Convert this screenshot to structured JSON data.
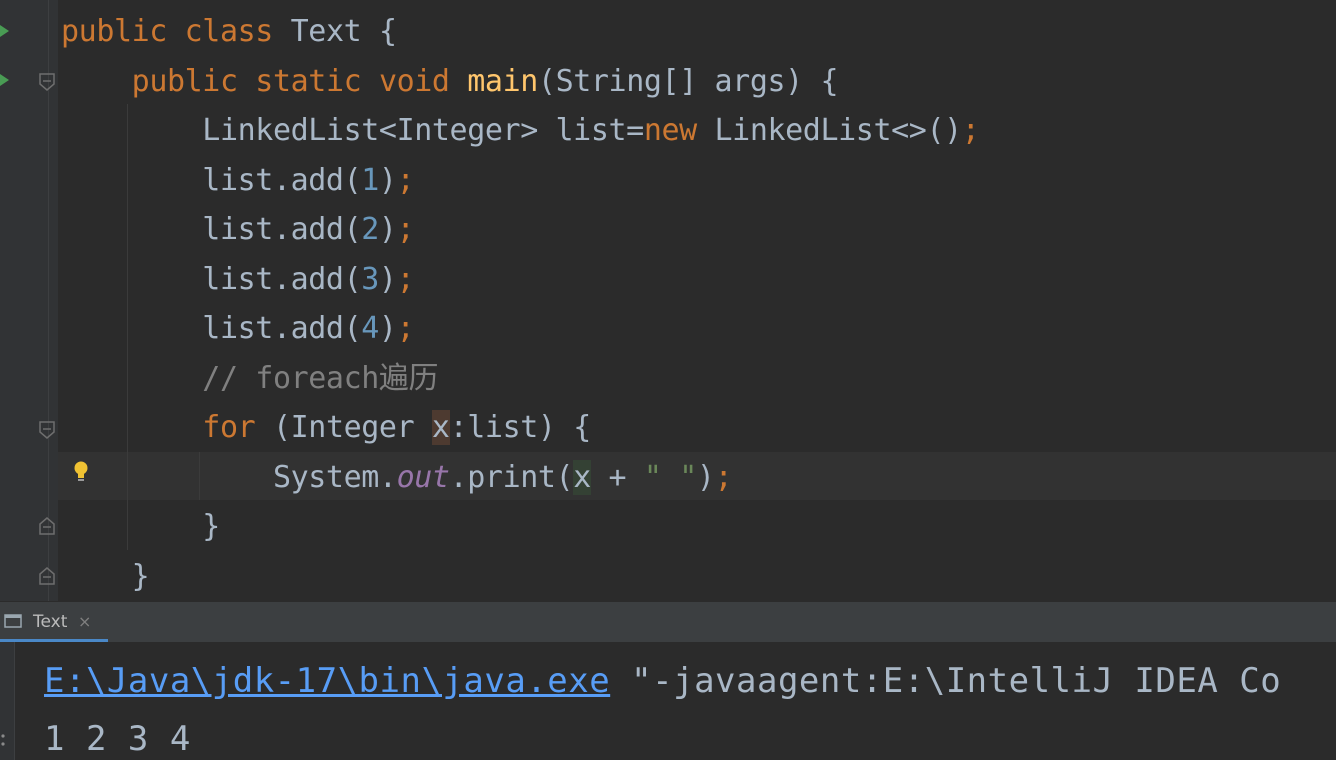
{
  "editor": {
    "lines": [
      {
        "parts": [
          [
            "kw",
            "public "
          ],
          [
            "kw",
            "class "
          ],
          [
            "plain",
            "Text "
          ],
          [
            "plain",
            "{"
          ]
        ]
      },
      {
        "parts": [
          [
            "plain",
            "    "
          ],
          [
            "kw",
            "public "
          ],
          [
            "kw",
            "static "
          ],
          [
            "kw",
            "void "
          ],
          [
            "fn",
            "main"
          ],
          [
            "plain",
            "(String[] args) {"
          ]
        ]
      },
      {
        "parts": [
          [
            "plain",
            "        LinkedList<Integer> list="
          ],
          [
            "kw",
            "new "
          ],
          [
            "plain",
            "LinkedList<>()"
          ],
          [
            "punct",
            ";"
          ]
        ]
      },
      {
        "parts": [
          [
            "plain",
            "        list.add("
          ],
          [
            "num",
            "1"
          ],
          [
            "plain",
            ")"
          ],
          [
            "punct",
            ";"
          ]
        ]
      },
      {
        "parts": [
          [
            "plain",
            "        list.add("
          ],
          [
            "num",
            "2"
          ],
          [
            "plain",
            ")"
          ],
          [
            "punct",
            ";"
          ]
        ]
      },
      {
        "parts": [
          [
            "plain",
            "        list.add("
          ],
          [
            "num",
            "3"
          ],
          [
            "plain",
            ")"
          ],
          [
            "punct",
            ";"
          ]
        ]
      },
      {
        "parts": [
          [
            "plain",
            "        list.add("
          ],
          [
            "num",
            "4"
          ],
          [
            "plain",
            ")"
          ],
          [
            "punct",
            ";"
          ]
        ]
      },
      {
        "parts": [
          [
            "plain",
            "        "
          ],
          [
            "cmt",
            "// foreach遍历"
          ]
        ]
      },
      {
        "parts": [
          [
            "plain",
            "        "
          ],
          [
            "kw",
            "for "
          ],
          [
            "plain",
            "(Integer "
          ],
          [
            "varhl",
            "x"
          ],
          [
            "plain",
            ":list) {"
          ]
        ]
      },
      {
        "parts": [
          [
            "plain",
            "            System."
          ],
          [
            "static",
            "out"
          ],
          [
            "plain",
            ".print("
          ],
          [
            "varhl2",
            "x"
          ],
          [
            "plain",
            " + "
          ],
          [
            "str",
            "\" \""
          ],
          [
            "plain",
            ")"
          ],
          [
            "punct",
            ";"
          ]
        ]
      },
      {
        "parts": [
          [
            "plain",
            "        }"
          ]
        ]
      },
      {
        "parts": [
          [
            "plain",
            "    }"
          ]
        ]
      }
    ]
  },
  "run_panel": {
    "tab_label": "Text",
    "tab_close": "×",
    "console_link": "E:\\Java\\jdk-17\\bin\\java.exe",
    "console_rest": " \"-javaagent:E:\\IntelliJ IDEA Co",
    "console_output": "1 2 3 4"
  },
  "icons": {
    "run": "run-gutter-icon",
    "fold": "fold-marker-icon",
    "bulb": "intention-bulb-icon",
    "tab": "console-tab-icon",
    "close": "close-icon"
  },
  "colors": {
    "keyword": "#cc7832",
    "method": "#ffc66d",
    "number": "#6897bb",
    "string": "#6a8759",
    "comment": "#808080",
    "static_field": "#9876aa",
    "link": "#589df6"
  }
}
